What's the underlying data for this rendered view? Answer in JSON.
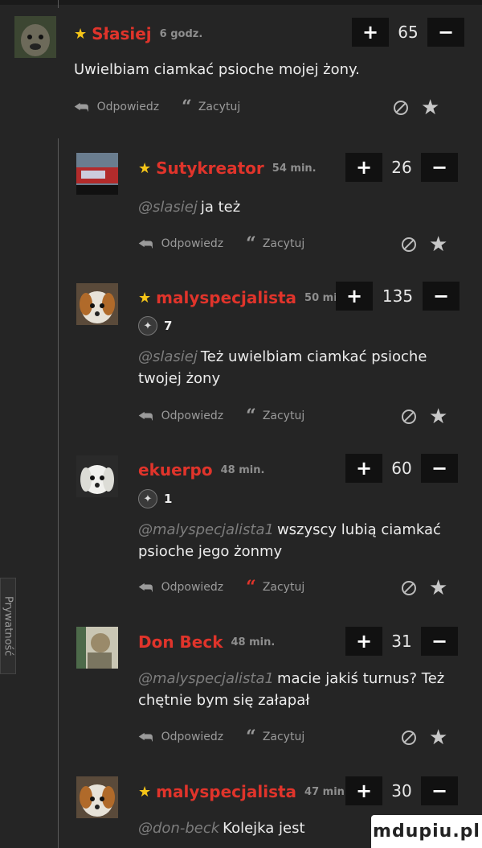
{
  "actions": {
    "reply": "Odpowiedz",
    "quote": "Zacytuj"
  },
  "sidebar_tab": "Prywatność",
  "watermark": "mdupiu.pl",
  "colors": {
    "username": "#e0342b",
    "star": "#f5c518",
    "background": "#252525"
  },
  "comments": [
    {
      "starred": true,
      "user": "Słasiej",
      "time": "6 godz.",
      "score": "65",
      "badge": "",
      "mention": "",
      "text": "Uwielbiam ciamkać psioche mojej żony.",
      "quote_red": false
    },
    {
      "starred": true,
      "user": "Sutykreator",
      "time": "54 min.",
      "score": "26",
      "badge": "",
      "mention": "@slasiej",
      "text": "ja też",
      "quote_red": false
    },
    {
      "starred": true,
      "user": "malyspecjalista",
      "time": "50 mi",
      "score": "135",
      "badge": "7",
      "mention": "@slasiej",
      "text": "Też uwielbiam ciamkać psioche twojej żony",
      "quote_red": false
    },
    {
      "starred": false,
      "user": "ekuerpo",
      "time": "48 min.",
      "score": "60",
      "badge": "1",
      "mention": "@malyspecjalista1",
      "text": "wszyscy lubią ciamkać psioche jego żonmy",
      "quote_red": true
    },
    {
      "starred": false,
      "user": "Don Beck",
      "time": "48 min.",
      "score": "31",
      "badge": "",
      "mention": "@malyspecjalista1",
      "text": "macie jakiś turnus? Też chętnie bym się załapał",
      "quote_red": false
    },
    {
      "starred": true,
      "user": "malyspecjalista",
      "time": "47 min.",
      "score": "30",
      "badge": "",
      "mention": "@don-beck",
      "text": "Kolejka jest",
      "quote_red": false
    }
  ]
}
